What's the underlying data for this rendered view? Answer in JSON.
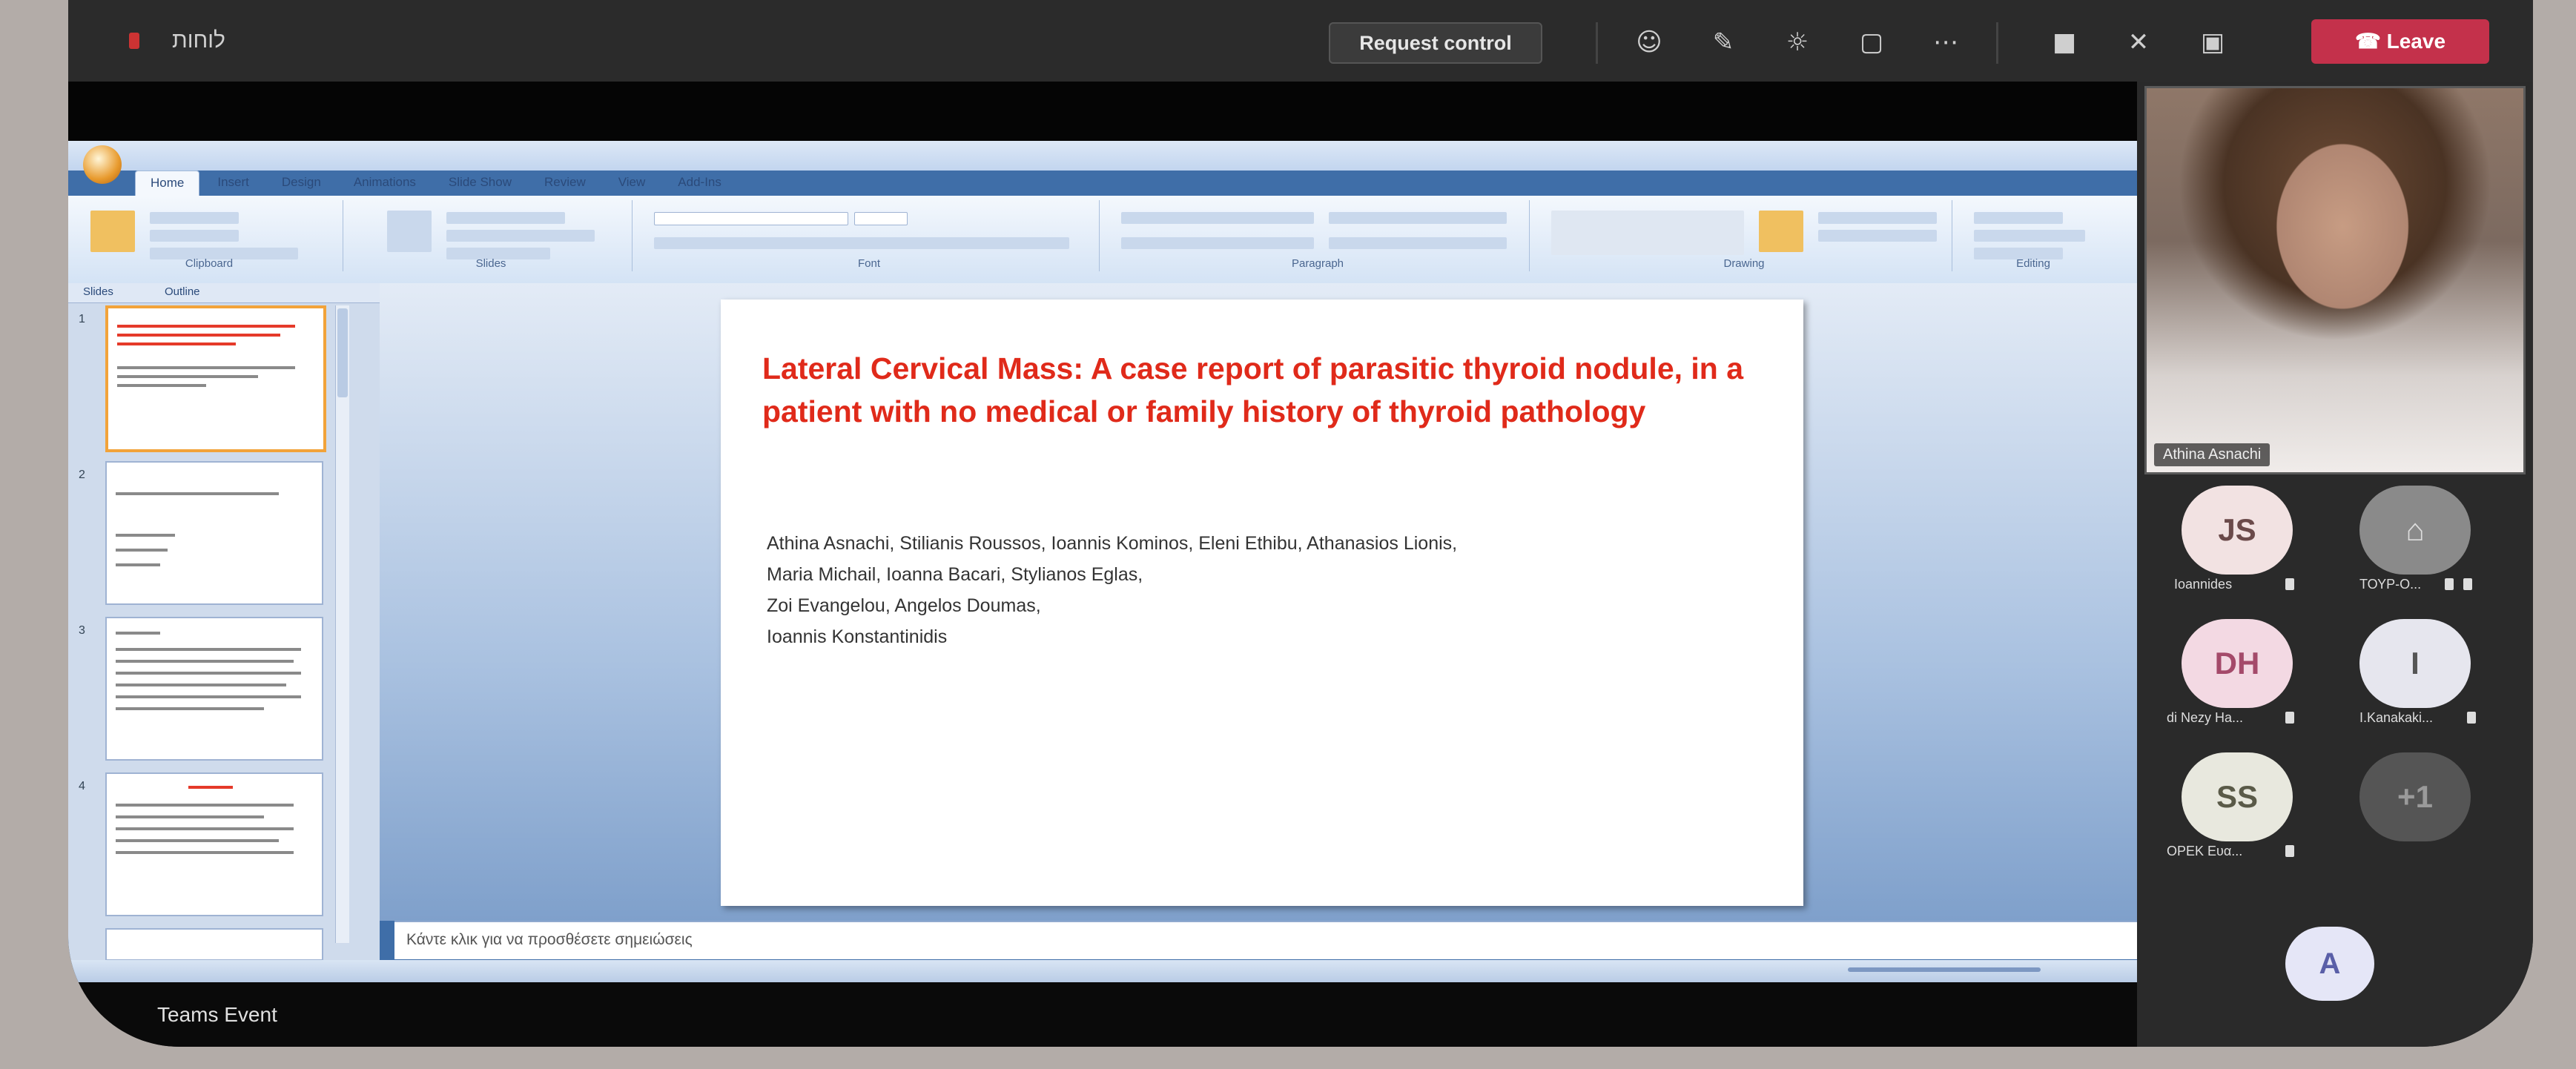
{
  "app": {
    "meeting_title": "לוחות",
    "request_control_label": "Request control",
    "leave_label": "Leave",
    "colors": {
      "leave": "#c4314b",
      "slide_title": "#e02a1a",
      "ribbon": "#d4e3f5"
    }
  },
  "toolbar_icons": [
    "participants-icon",
    "chat-icon",
    "reactions-icon",
    "rooms-icon",
    "more-icon",
    "camera-icon",
    "mic-icon",
    "share-icon"
  ],
  "powerpoint": {
    "tabs": [
      "Home",
      "Insert",
      "Design",
      "Animations",
      "Slide Show",
      "Review",
      "View",
      "Add-Ins"
    ],
    "ribbon_groups": [
      "Clipboard",
      "Slides",
      "Font",
      "Paragraph",
      "Drawing",
      "Editing"
    ],
    "panel_tabs": [
      "Slides",
      "Outline"
    ],
    "slide": {
      "title": "Lateral Cervical Mass: A case report of parasitic thyroid nodule, in a patient with no medical or family history of thyroid pathology",
      "authors_line1": "Athina Asnachi, Stilianis Roussos, Ioannis Kominos, Eleni Ethibu, Athanasios Lionis,",
      "authors_line2": "Maria Michail, Ioanna Bacari, Stylianos Eglas,",
      "authors_line3": "Zoi Evangelou, Angelos Doumas,",
      "authors_line4": "Ioannis Konstantinidis"
    },
    "notes": "Κάντε κλικ για να προσθέσετε σημειώσεις"
  },
  "presenter_label": "Teams Event",
  "video": {
    "name": "Athina Asnachi"
  },
  "participants": [
    {
      "initials": "JS",
      "name": "Ioannides",
      "bg": "#f2e2e2",
      "fg": "#6b4a4a"
    },
    {
      "initials": "",
      "name": "ΤΟΥΡ-Ο...",
      "bg": "#8a8a8a",
      "fg": "#ddd"
    },
    {
      "initials": "DH",
      "name": "di Nezy Ha...",
      "bg": "#f3d9e3",
      "fg": "#a44a6a"
    },
    {
      "initials": "I",
      "name": "I.Kanakaki...",
      "bg": "#e6e6ee",
      "fg": "#555"
    },
    {
      "initials": "SS",
      "name": "ΟΡΕΚ Ευα...",
      "bg": "#e8e8de",
      "fg": "#5a5a48"
    },
    {
      "initials": "+1",
      "name": "",
      "bg": "#555",
      "fg": "#9a9a9a"
    }
  ],
  "self": {
    "initials": "A"
  }
}
